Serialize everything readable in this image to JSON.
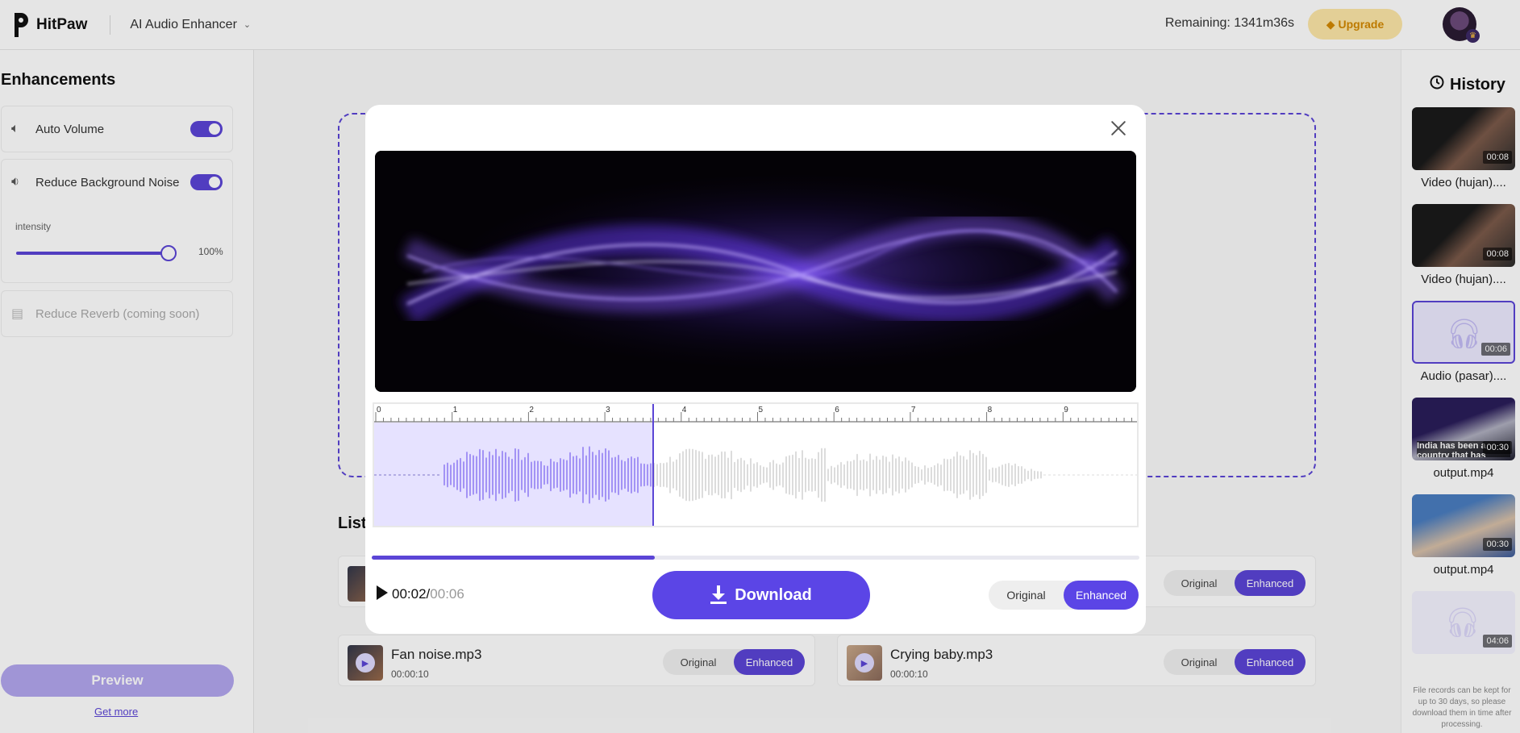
{
  "header": {
    "logo_text": "HitPaw",
    "product_name": "AI Audio Enhancer",
    "remaining": "Remaining: 1341m36s",
    "upgrade_label": "Upgrade"
  },
  "left_panel": {
    "title": "Enhancements",
    "auto_volume": {
      "label": "Auto Volume",
      "enabled": true
    },
    "reduce_noise": {
      "label": "Reduce Background Noise",
      "enabled": true
    },
    "intensity": {
      "label": "intensity",
      "value_text": "100%",
      "value": 1.0
    },
    "reduce_reverb": {
      "label": "Reduce Reverb (coming soon)"
    },
    "preview_label": "Preview",
    "get_more_label": "Get more"
  },
  "main": {
    "list_title": "List",
    "files": [
      {
        "name": "Fan noise.mp3",
        "duration": "00:00:10",
        "options": [
          "Original",
          "Enhanced"
        ],
        "selected": "Enhanced"
      },
      {
        "name": "Crying baby.mp3",
        "duration": "00:00:10",
        "options": [
          "Original",
          "Enhanced"
        ],
        "selected": "Enhanced"
      }
    ],
    "hidden_row_options": [
      "Original",
      "Enhanced"
    ]
  },
  "history": {
    "title": "History",
    "items": [
      {
        "name": "Video (hujan)....",
        "duration": "00:08",
        "kind": "video1"
      },
      {
        "name": "Video (hujan)....",
        "duration": "00:08",
        "kind": "video1"
      },
      {
        "name": "Audio (pasar)....",
        "duration": "00:06",
        "kind": "audio"
      },
      {
        "name": "output.mp4",
        "duration": "00:30",
        "kind": "video2",
        "caption": "India has been a country that has"
      },
      {
        "name": "output.mp4",
        "duration": "00:30",
        "kind": "video3"
      },
      {
        "name": "",
        "duration": "04:06",
        "kind": "audio-faded"
      }
    ],
    "note": "File records can be kept for up to 30 days, so please download them in time after processing."
  },
  "modal": {
    "time_current": "00:02",
    "time_separator": "/",
    "time_total": "00:06",
    "progress": 0.3685,
    "download_label": "Download",
    "options": [
      "Original",
      "Enhanced"
    ],
    "selected_option": "Enhanced",
    "ruler_labels": [
      "0",
      "1",
      "2",
      "3",
      "4",
      "5",
      "6",
      "7",
      "8",
      "9"
    ],
    "played_color": "#a393f5",
    "unplayed_color": "#dcdcdc",
    "accent": "#5b45e6"
  }
}
